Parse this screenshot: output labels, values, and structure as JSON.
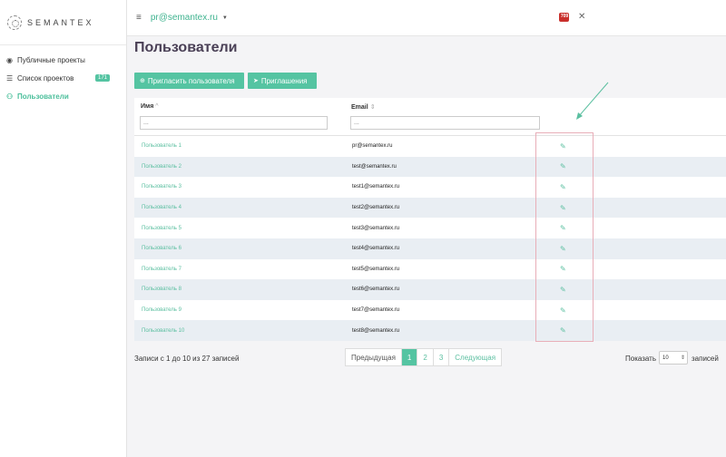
{
  "brand": {
    "name": "SEMANTEX"
  },
  "topbar": {
    "account": "pr@semantex.ru",
    "notifications": "709"
  },
  "sidebar": {
    "items": [
      {
        "label": "Публичные проекты",
        "icon": "eye-icon"
      },
      {
        "label": "Список проектов",
        "icon": "list-icon",
        "badge": "171"
      },
      {
        "label": "Пользователи",
        "icon": "users-icon"
      }
    ]
  },
  "page": {
    "title": "Пользователи"
  },
  "actions": {
    "invite": "Пригласить пользователя",
    "invitations": "Приглашения"
  },
  "table": {
    "columns": [
      {
        "label": "Имя",
        "sort": "^"
      },
      {
        "label": "Email",
        "sort": "⇕"
      }
    ],
    "filters": {
      "name_placeholder": "...",
      "email_placeholder": "..."
    },
    "rows": [
      {
        "name": "Пользователь 1",
        "email": "pr@semantex.ru"
      },
      {
        "name": "Пользователь 2",
        "email": "test@semantex.ru"
      },
      {
        "name": "Пользователь 3",
        "email": "test1@semantex.ru"
      },
      {
        "name": "Пользователь 4",
        "email": "test2@semantex.ru"
      },
      {
        "name": "Пользователь 5",
        "email": "test3@semantex.ru"
      },
      {
        "name": "Пользователь 6",
        "email": "test4@semantex.ru"
      },
      {
        "name": "Пользователь 7",
        "email": "test5@semantex.ru"
      },
      {
        "name": "Пользователь 8",
        "email": "test6@semantex.ru"
      },
      {
        "name": "Пользователь 9",
        "email": "test7@semantex.ru"
      },
      {
        "name": "Пользователь 10",
        "email": "test8@semantex.ru"
      }
    ]
  },
  "footer": {
    "records": "Записи с 1 до 10 из 27 записей",
    "pager": {
      "prev": "Предыдущая",
      "pages": [
        "1",
        "2",
        "3"
      ],
      "next": "Следующая"
    },
    "show_label": "Показать",
    "page_size": "10",
    "show_suffix": "записей"
  },
  "colors": {
    "accent": "#55c4a2",
    "title": "#4a4056",
    "highlight": "#e8aeb8",
    "row_alt": "#e9eef3"
  }
}
